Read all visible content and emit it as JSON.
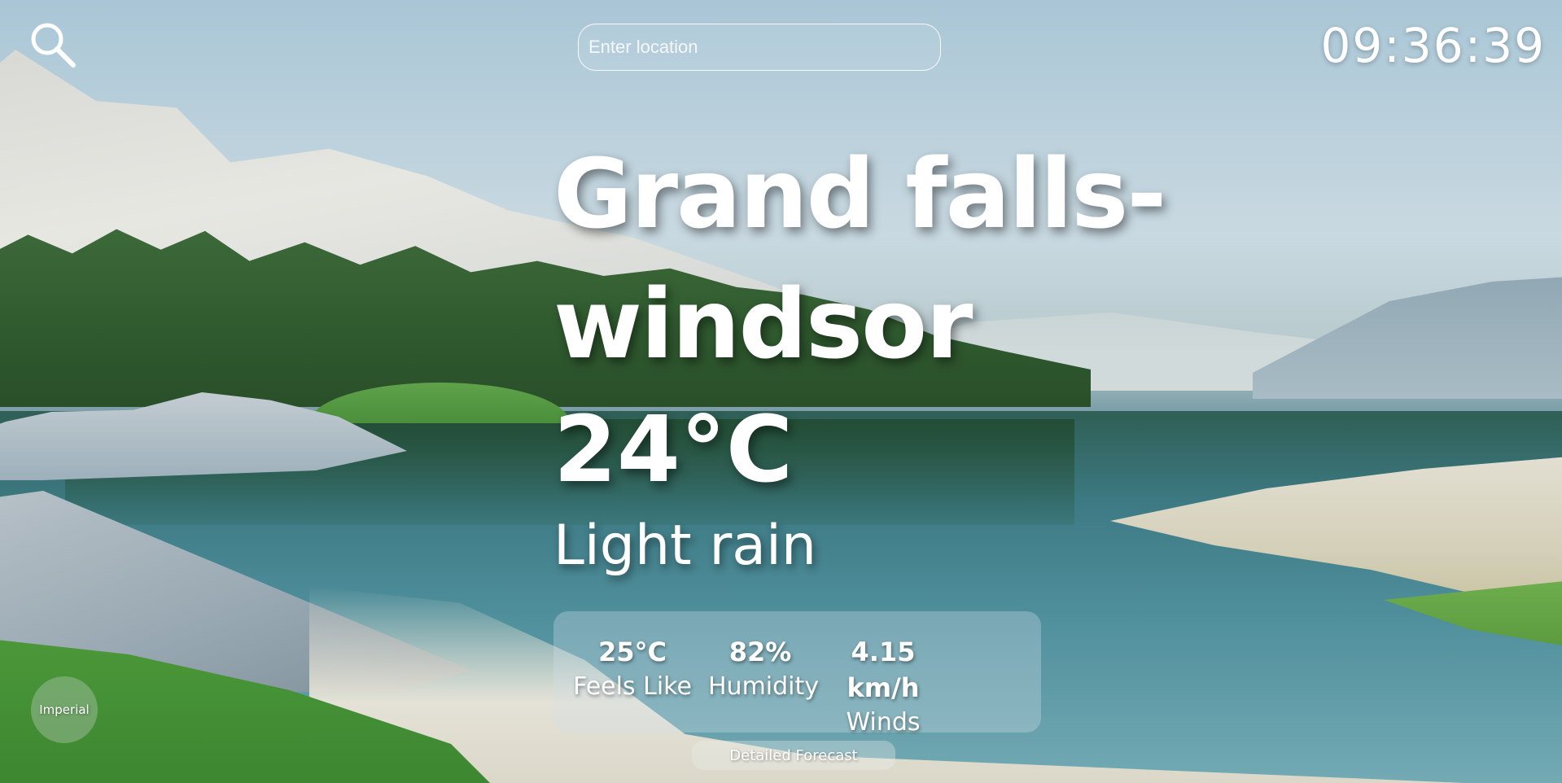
{
  "header": {
    "search_icon": "search-icon",
    "location_input": {
      "value": "",
      "placeholder": "Enter location"
    },
    "clock": "09:36:39"
  },
  "weather": {
    "city_line1": "Grand falls-",
    "city_line2": "windsor",
    "temperature": "24°C",
    "condition": "Light rain"
  },
  "stats": {
    "feels_like": {
      "value": "25°C",
      "label": "Feels Like"
    },
    "humidity": {
      "value": "82%",
      "label": "Humidity"
    },
    "winds": {
      "value": "4.15 km/h",
      "label": "Winds"
    }
  },
  "controls": {
    "units_button": "Imperial",
    "forecast_button": "Detailed Forecast"
  },
  "colors": {
    "text": "#ffffff",
    "panel": "rgba(210,225,232,0.32)"
  }
}
